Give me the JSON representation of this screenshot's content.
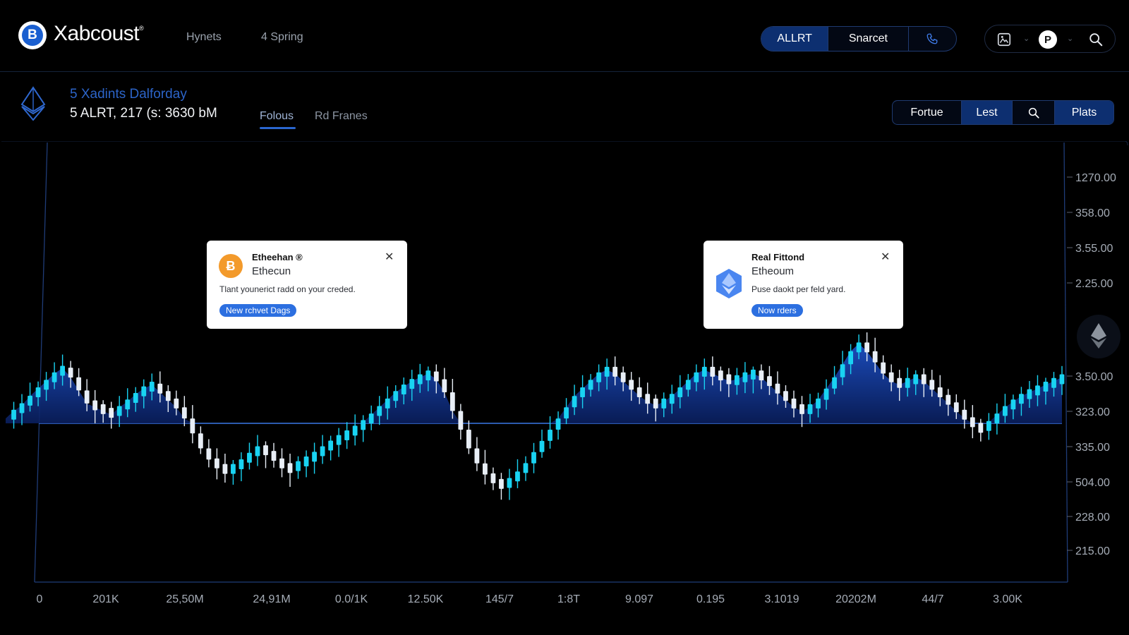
{
  "app": {
    "brand": "Xabcoust",
    "trademark": "®",
    "logo_letter": "B"
  },
  "nav": {
    "links": [
      "Hynets",
      "4 Spring"
    ]
  },
  "header_actions": {
    "segments": [
      "ALLRT",
      "Snarcet"
    ],
    "phone_icon": "phone-icon",
    "active": "ALLRT"
  },
  "user_menu": {
    "icons": [
      "image-icon",
      "chevron-down-icon",
      "coin-icon",
      "chevron-down-icon",
      "search-icon"
    ],
    "coin_letter": "P"
  },
  "asset": {
    "title": "5 Xadints Dalforday",
    "summary": "5 ALRT, 217 (s: 3630 bM",
    "icon": "ethereum-icon"
  },
  "tabs": [
    {
      "label": "Folous",
      "active": true
    },
    {
      "label": "Rd Franes",
      "active": false
    }
  ],
  "toolbar": {
    "segments": [
      {
        "label": "Fortue",
        "active": false
      },
      {
        "label": "Lest",
        "active": true
      },
      {
        "label": "",
        "icon": "search-icon",
        "active": false
      },
      {
        "label": "Plats",
        "active": true
      }
    ]
  },
  "popups": [
    {
      "title": "Etheehan ®",
      "subtitle": "Ethecun",
      "body": "Tlant younerict radd on your creded.",
      "button": "New rchvet Dags",
      "icon": "bitcoin-icon",
      "coin_letter": "Ƀ",
      "close_icon": "close-icon"
    },
    {
      "title": "Real Fittond",
      "subtitle": "Etheoum",
      "body": "Puse daokt per feld yard.",
      "button": "Now rders",
      "icon": "ethereum-icon",
      "close_icon": "close-icon"
    }
  ],
  "colors": {
    "background": "#000000",
    "accent_blue": "#2c6fe0",
    "candle_up": "#19d3f2",
    "candle_down": "#e8eef6",
    "area_fill": "#123a9a"
  },
  "chart_data": {
    "type": "candlestick",
    "y_tick_labels": [
      "1270.00",
      "358.00",
      "3.55.00",
      "2.25.00",
      "3.50.00",
      "323.00",
      "335.00",
      "504.00",
      "228.00",
      "215.00"
    ],
    "x_tick_labels": [
      "0",
      "201K",
      "25,50M",
      "24,91M",
      "0.0/1K",
      "12.50K",
      "145/7",
      "1:8T",
      "9.097",
      "0.195",
      "3.1019",
      "20202M",
      "44/7",
      "3.00K"
    ],
    "baseline": "323.00",
    "grid": false,
    "close_series": [
      0.46,
      0.5,
      0.53,
      0.58,
      0.62,
      0.66,
      0.7,
      0.73,
      0.68,
      0.61,
      0.54,
      0.52,
      0.5,
      0.48,
      0.52,
      0.55,
      0.59,
      0.62,
      0.64,
      0.6,
      0.56,
      0.52,
      0.46,
      0.38,
      0.3,
      0.24,
      0.2,
      0.18,
      0.2,
      0.23,
      0.27,
      0.3,
      0.28,
      0.24,
      0.2,
      0.19,
      0.22,
      0.24,
      0.27,
      0.3,
      0.33,
      0.36,
      0.38,
      0.41,
      0.44,
      0.48,
      0.52,
      0.56,
      0.6,
      0.63,
      0.66,
      0.68,
      0.7,
      0.67,
      0.6,
      0.5,
      0.4,
      0.3,
      0.22,
      0.16,
      0.12,
      0.1,
      0.13,
      0.17,
      0.22,
      0.28,
      0.34,
      0.4,
      0.46,
      0.52,
      0.58,
      0.62,
      0.66,
      0.7,
      0.72,
      0.7,
      0.66,
      0.62,
      0.58,
      0.55,
      0.53,
      0.55,
      0.58,
      0.62,
      0.66,
      0.7,
      0.72,
      0.7,
      0.68,
      0.66,
      0.67,
      0.69,
      0.7,
      0.68,
      0.64,
      0.6,
      0.56,
      0.52,
      0.5,
      0.52,
      0.56,
      0.62,
      0.68,
      0.75,
      0.82,
      0.86,
      0.82,
      0.76,
      0.7,
      0.66,
      0.64,
      0.66,
      0.68,
      0.66,
      0.62,
      0.58,
      0.54,
      0.5,
      0.46,
      0.42,
      0.4,
      0.44,
      0.48,
      0.52,
      0.55,
      0.58,
      0.6,
      0.62,
      0.64,
      0.66,
      0.68
    ]
  }
}
